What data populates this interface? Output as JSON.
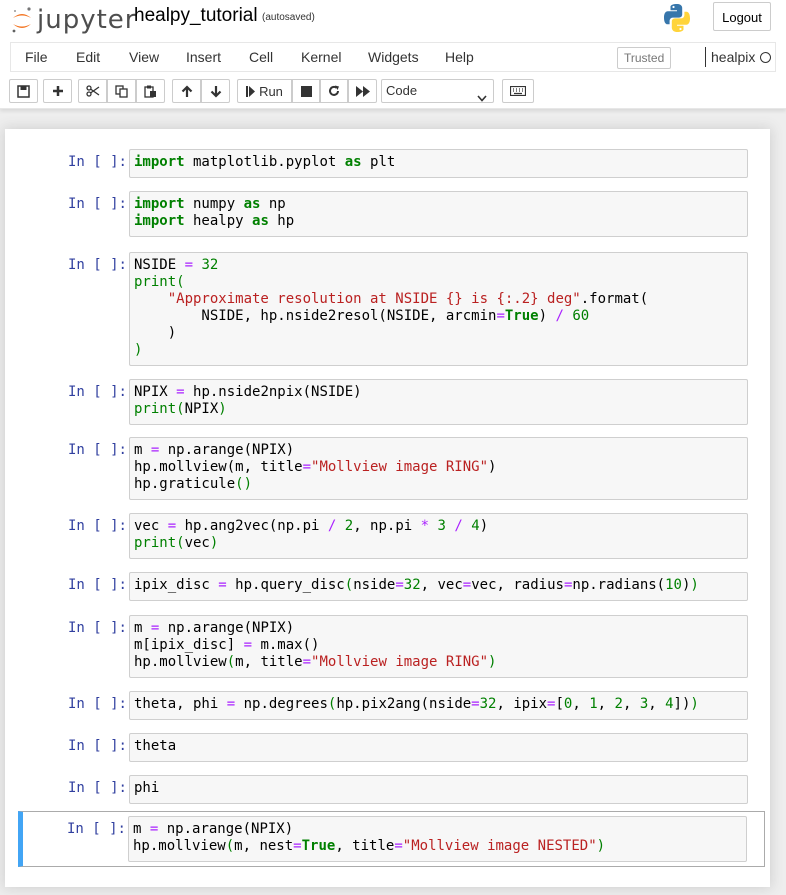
{
  "header": {
    "logo_text": "jupyter",
    "notebook_name": "healpy_tutorial",
    "autosave": "(autosaved)",
    "logout_label": "Logout"
  },
  "menu": {
    "items": [
      "File",
      "Edit",
      "View",
      "Insert",
      "Cell",
      "Kernel",
      "Widgets",
      "Help"
    ],
    "trusted": "Trusted",
    "kernel": "healpix"
  },
  "toolbar": {
    "run_label": "Run",
    "cell_type": "Code"
  },
  "cells": [
    {
      "prompt": "In [ ]:",
      "lines": [
        [
          [
            "kw",
            "import"
          ],
          [
            "t",
            " matplotlib.pyplot "
          ],
          [
            "kw",
            "as"
          ],
          [
            "t",
            " plt"
          ]
        ]
      ]
    },
    {
      "prompt": "In [ ]:",
      "lines": [
        [
          [
            "kw",
            "import"
          ],
          [
            "t",
            " numpy "
          ],
          [
            "kw",
            "as"
          ],
          [
            "t",
            " np"
          ]
        ],
        [
          [
            "kw",
            "import"
          ],
          [
            "t",
            " healpy "
          ],
          [
            "kw",
            "as"
          ],
          [
            "t",
            " hp"
          ]
        ]
      ]
    },
    {
      "prompt": "In [ ]:",
      "lines": [
        [
          [
            "t",
            "NSIDE "
          ],
          [
            "op",
            "="
          ],
          [
            "t",
            " "
          ],
          [
            "num",
            "32"
          ]
        ],
        [
          [
            "bi",
            "print("
          ]
        ],
        [
          [
            "t",
            "    "
          ],
          [
            "str",
            "\"Approximate resolution at NSIDE {} is {:.2} deg\""
          ],
          [
            "t",
            ".format("
          ]
        ],
        [
          [
            "t",
            "        NSIDE, hp.nside2resol(NSIDE, arcmin"
          ],
          [
            "op",
            "="
          ],
          [
            "kw",
            "True"
          ],
          [
            "t",
            ") "
          ],
          [
            "op",
            "/"
          ],
          [
            "t",
            " "
          ],
          [
            "num",
            "60"
          ]
        ],
        [
          [
            "t",
            "    )"
          ]
        ],
        [
          [
            "bi",
            ")"
          ]
        ]
      ]
    },
    {
      "prompt": "In [ ]:",
      "lines": [
        [
          [
            "t",
            "NPIX "
          ],
          [
            "op",
            "="
          ],
          [
            "t",
            " hp.nside2npix(NSIDE)"
          ]
        ],
        [
          [
            "bi",
            "print("
          ],
          [
            "t",
            "NPIX"
          ],
          [
            "bi",
            ")"
          ]
        ]
      ]
    },
    {
      "prompt": "In [ ]:",
      "lines": [
        [
          [
            "t",
            "m "
          ],
          [
            "op",
            "="
          ],
          [
            "t",
            " np.arange(NPIX)"
          ]
        ],
        [
          [
            "t",
            "hp.mollview(m, title"
          ],
          [
            "op",
            "="
          ],
          [
            "str",
            "\"Mollview image RING\""
          ],
          [
            "t",
            ")"
          ]
        ],
        [
          [
            "t",
            "hp.graticule"
          ],
          [
            "bi",
            "()"
          ]
        ]
      ]
    },
    {
      "prompt": "In [ ]:",
      "lines": [
        [
          [
            "t",
            "vec "
          ],
          [
            "op",
            "="
          ],
          [
            "t",
            " hp.ang2vec(np.pi "
          ],
          [
            "op",
            "/"
          ],
          [
            "t",
            " "
          ],
          [
            "num",
            "2"
          ],
          [
            "t",
            ", np.pi "
          ],
          [
            "op",
            "*"
          ],
          [
            "t",
            " "
          ],
          [
            "num",
            "3"
          ],
          [
            "t",
            " "
          ],
          [
            "op",
            "/"
          ],
          [
            "t",
            " "
          ],
          [
            "num",
            "4"
          ],
          [
            "t",
            ")"
          ]
        ],
        [
          [
            "bi",
            "print("
          ],
          [
            "t",
            "vec"
          ],
          [
            "bi",
            ")"
          ]
        ]
      ]
    },
    {
      "prompt": "In [ ]:",
      "lines": [
        [
          [
            "t",
            "ipix_disc "
          ],
          [
            "op",
            "="
          ],
          [
            "t",
            " hp.query_disc"
          ],
          [
            "bi",
            "("
          ],
          [
            "t",
            "nside"
          ],
          [
            "op",
            "="
          ],
          [
            "num",
            "32"
          ],
          [
            "t",
            ", vec"
          ],
          [
            "op",
            "="
          ],
          [
            "t",
            "vec, radius"
          ],
          [
            "op",
            "="
          ],
          [
            "t",
            "np.radians("
          ],
          [
            "num",
            "10"
          ],
          [
            "t",
            ")"
          ],
          [
            "bi",
            ")"
          ]
        ]
      ]
    },
    {
      "prompt": "In [ ]:",
      "lines": [
        [
          [
            "t",
            "m "
          ],
          [
            "op",
            "="
          ],
          [
            "t",
            " np.arange(NPIX)"
          ]
        ],
        [
          [
            "t",
            "m[ipix_disc] "
          ],
          [
            "op",
            "="
          ],
          [
            "t",
            " m.max()"
          ]
        ],
        [
          [
            "t",
            "hp.mollview"
          ],
          [
            "bi",
            "("
          ],
          [
            "t",
            "m, title"
          ],
          [
            "op",
            "="
          ],
          [
            "str",
            "\"Mollview image RING\""
          ],
          [
            "bi",
            ")"
          ]
        ]
      ]
    },
    {
      "prompt": "In [ ]:",
      "lines": [
        [
          [
            "t",
            "theta, phi "
          ],
          [
            "op",
            "="
          ],
          [
            "t",
            " np.degrees"
          ],
          [
            "bi",
            "("
          ],
          [
            "t",
            "hp.pix2ang(nside"
          ],
          [
            "op",
            "="
          ],
          [
            "num",
            "32"
          ],
          [
            "t",
            ", ipix"
          ],
          [
            "op",
            "="
          ],
          [
            "t",
            "["
          ],
          [
            "num",
            "0"
          ],
          [
            "t",
            ", "
          ],
          [
            "num",
            "1"
          ],
          [
            "t",
            ", "
          ],
          [
            "num",
            "2"
          ],
          [
            "t",
            ", "
          ],
          [
            "num",
            "3"
          ],
          [
            "t",
            ", "
          ],
          [
            "num",
            "4"
          ],
          [
            "t",
            "])"
          ],
          [
            "bi",
            ")"
          ]
        ]
      ]
    },
    {
      "prompt": "In [ ]:",
      "lines": [
        [
          [
            "t",
            "theta"
          ]
        ]
      ]
    },
    {
      "prompt": "In [ ]:",
      "lines": [
        [
          [
            "t",
            "phi"
          ]
        ]
      ]
    },
    {
      "prompt": "In [ ]:",
      "selected": true,
      "lines": [
        [
          [
            "t",
            "m "
          ],
          [
            "op",
            "="
          ],
          [
            "t",
            " np.arange(NPIX)"
          ]
        ],
        [
          [
            "t",
            "hp.mollview"
          ],
          [
            "bi",
            "("
          ],
          [
            "t",
            "m, nest"
          ],
          [
            "op",
            "="
          ],
          [
            "kw",
            "True"
          ],
          [
            "t",
            ", title"
          ],
          [
            "op",
            "="
          ],
          [
            "str",
            "\"Mollview image NESTED\""
          ],
          [
            "bi",
            ")"
          ]
        ]
      ]
    }
  ]
}
